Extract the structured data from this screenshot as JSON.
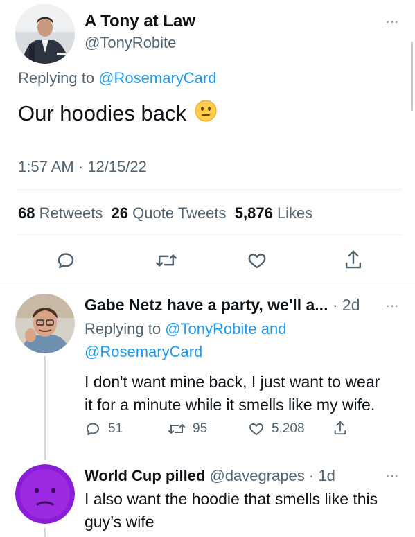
{
  "main_tweet": {
    "display_name": "A Tony at Law",
    "handle": "@TonyRobite",
    "more": "···",
    "replying_prefix": "Replying to",
    "replying_to": "@RosemaryCard",
    "text": "Our hoodies back",
    "emoji": "neutral-face-emoji",
    "time": "1:57 AM · 12/15/22",
    "stats": {
      "retweets_count": "68",
      "retweets_label": "Retweets",
      "quotes_count": "26",
      "quotes_label": "Quote Tweets",
      "likes_count": "5,876",
      "likes_label": "Likes"
    }
  },
  "reply1": {
    "display_name": "Gabe Netz have a party, we'll a...",
    "age": "· 2d",
    "more": "···",
    "replying_prefix": "Replying to",
    "replying_to_1": "@TonyRobite",
    "and": "and",
    "replying_to_2": "@RosemaryCard",
    "text_line1": "I don't want mine back, I just want to wear",
    "text_line2": "it for a minute while it smells like my wife.",
    "replies": "51",
    "retweets": "95",
    "likes": "5,208"
  },
  "reply2": {
    "display_name": "World Cup pilled",
    "handle": "@davegrapes",
    "age": "· 1d",
    "more": "···",
    "text_line1": "I also want the hoodie that smells like this",
    "text_line2": "guy’s wife"
  },
  "colors": {
    "accent": "#1d9bf0",
    "secondary_text": "#536471",
    "divider": "#eff3f4",
    "avatar_purple": "#8a1dd6"
  }
}
